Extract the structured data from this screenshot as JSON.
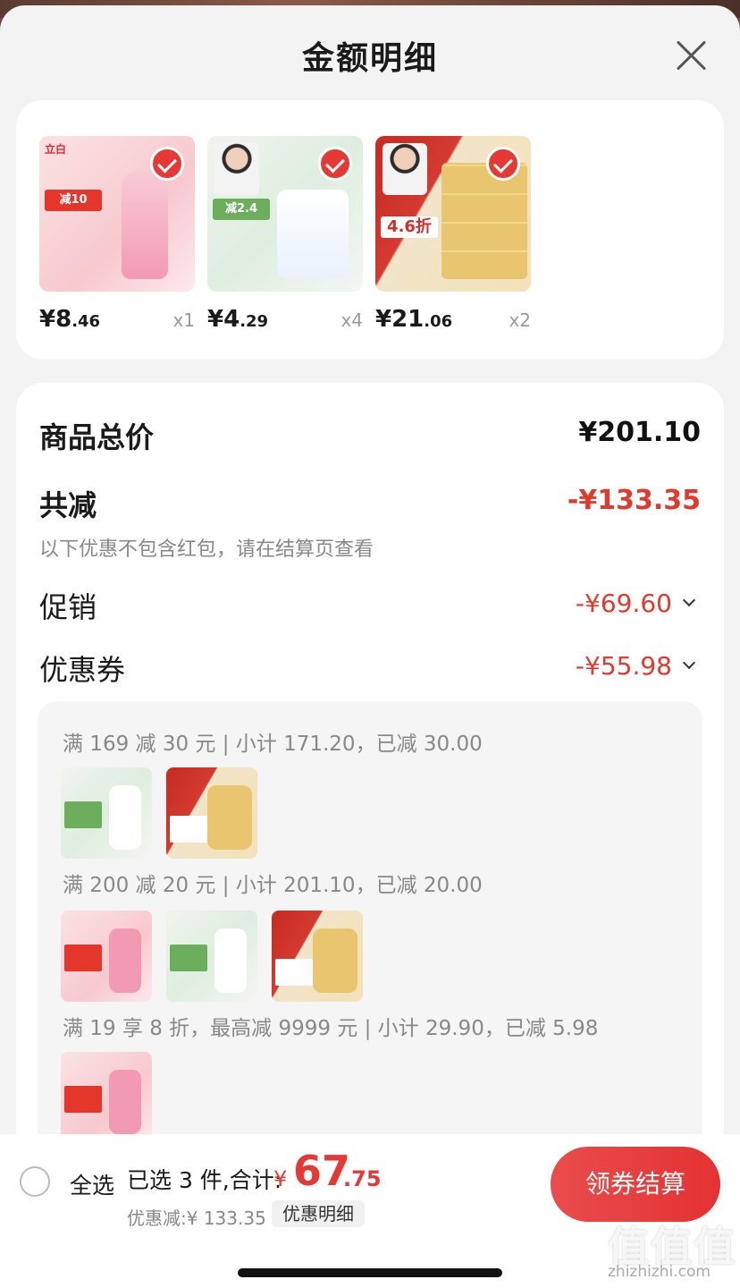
{
  "sheet": {
    "title": "金额明细"
  },
  "products": [
    {
      "price_main": "¥8",
      "price_dec": ".46",
      "qty": "x1",
      "badge": "check-icon",
      "tag_text": "减10",
      "brand_text": "立白"
    },
    {
      "price_main": "¥4",
      "price_dec": ".29",
      "qty": "x4",
      "badge": "check-icon",
      "tag_text": "减2.4",
      "brand_text": ""
    },
    {
      "price_main": "¥21",
      "price_dec": ".06",
      "qty": "x2",
      "badge": "check-icon",
      "tag_text": "4.6折",
      "brand_text": ""
    }
  ],
  "detail": {
    "total_label": "商品总价",
    "total_value": "¥201.10",
    "reduce_label": "共减",
    "reduce_value": "-¥133.35",
    "reduce_note": "以下优惠不包含红包，请在结算页查看",
    "promo_label": "促销",
    "promo_value": "-¥69.60",
    "coupon_label": "优惠券",
    "coupon_value": "-¥55.98"
  },
  "coupons": [
    {
      "text": "满 169 减 30 元 | 小计 171.20，已减 30.00"
    },
    {
      "text": "满 200 减 20 元 | 小计 201.10，已减 20.00"
    },
    {
      "text": "满 19 享 8 折，最高减 9999 元 | 小计 29.90，已减 5.98"
    }
  ],
  "bottom": {
    "select_all": "全选",
    "selected_summary": "已选 3 件,合计:",
    "currency": "¥",
    "total_int": "67",
    "total_dec": ".75",
    "discount_text": "优惠减:¥ 133.35",
    "detail_chip": "优惠明细",
    "checkout": "领券结算"
  },
  "watermark": {
    "logo": "值值值",
    "url": "zhizhizhi.com"
  },
  "colors": {
    "accent": "#e53935",
    "background": "#f3f3f3",
    "card": "#ffffff"
  }
}
